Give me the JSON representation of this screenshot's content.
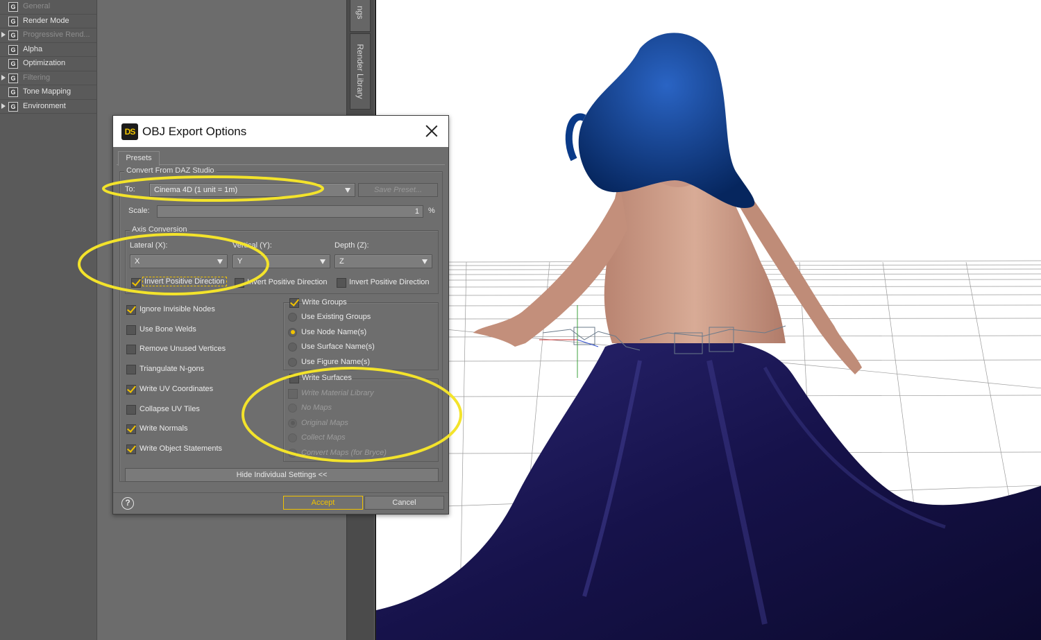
{
  "left_panel": {
    "items": [
      {
        "label": "General",
        "has_arrow": false,
        "dim": true
      },
      {
        "label": "Render Mode",
        "has_arrow": false,
        "dim": false
      },
      {
        "label": "Progressive Rend...",
        "has_arrow": true,
        "dim": true
      },
      {
        "label": "Alpha",
        "has_arrow": false,
        "dim": false
      },
      {
        "label": "Optimization",
        "has_arrow": false,
        "dim": false
      },
      {
        "label": "Filtering",
        "has_arrow": true,
        "dim": true
      },
      {
        "label": "Tone Mapping",
        "has_arrow": false,
        "dim": false
      },
      {
        "label": "Environment",
        "has_arrow": true,
        "dim": false
      }
    ],
    "group_icon_letter": "G"
  },
  "side_tabs": {
    "settings": "ngs",
    "library": "Render Library"
  },
  "dialog": {
    "logo": "DS",
    "title": "OBJ Export Options",
    "tab": "Presets",
    "convert_group": "Convert From DAZ Studio",
    "to_label": "To:",
    "to_value": "Cinema 4D (1 unit = 1m)",
    "save_preset": "Save Preset...",
    "scale_label": "Scale:",
    "scale_value": "1",
    "scale_unit": "%",
    "axis_group": "Axis Conversion",
    "lateral_label": "Lateral (X):",
    "vertical_label": "Vertical (Y):",
    "depth_label": "Depth (Z):",
    "lateral_value": "X",
    "vertical_value": "Y",
    "depth_value": "Z",
    "invert_label": "Invert Positive Direction",
    "left_options": [
      {
        "label": "Ignore Invisible Nodes",
        "checked": true
      },
      {
        "label": "Use Bone Welds",
        "checked": false
      },
      {
        "label": "Remove Unused Vertices",
        "checked": false
      },
      {
        "label": "Triangulate N-gons",
        "checked": false
      },
      {
        "label": "Write UV Coordinates",
        "checked": true
      },
      {
        "label": "Collapse UV Tiles",
        "checked": false
      },
      {
        "label": "Write Normals",
        "checked": true
      },
      {
        "label": "Write Object Statements",
        "checked": true
      }
    ],
    "write_groups": {
      "label": "Write Groups",
      "options": [
        "Use Existing Groups",
        "Use Node Name(s)",
        "Use Surface Name(s)",
        "Use Figure Name(s)"
      ],
      "selected": 1
    },
    "write_surfaces": {
      "label": "Write Surfaces",
      "material_library": "Write Material Library",
      "options": [
        "No Maps",
        "Original Maps",
        "Collect Maps",
        "Convert Maps (for Bryce)"
      ],
      "selected": 1
    },
    "hide_settings": "Hide Individual Settings <<",
    "help": "?",
    "accept": "Accept",
    "cancel": "Cancel"
  },
  "colors": {
    "accent": "#f2c300",
    "highlight": "#f3e32b",
    "dialog_bg": "#6e6e6e",
    "hair": "#0d3f8f",
    "dress": "#1e1a5c",
    "skin": "#c99a86"
  }
}
